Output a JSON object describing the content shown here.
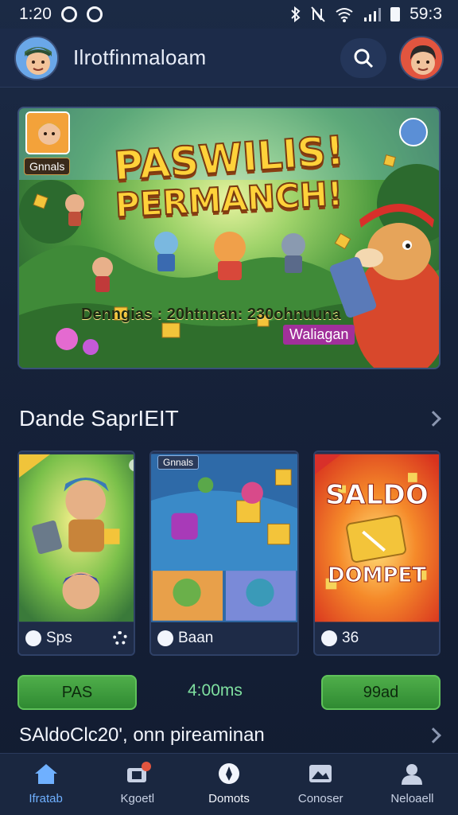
{
  "status_bar": {
    "time": "1:20",
    "battery_time": "59:3"
  },
  "header": {
    "title": "Ilrotfinmaloam"
  },
  "hero": {
    "title_line1": "PASWILIS!",
    "title_line2": "PERMANCH!",
    "chip": "Gnnals",
    "stats": "Denngias : 20htnnan: 230ohnuuna",
    "badge": "Waliagan"
  },
  "section1": {
    "title": "Dande SaprIEIT"
  },
  "cards": [
    {
      "label": "Sps"
    },
    {
      "badge": "Gnnals",
      "label": "Baan"
    },
    {
      "title_line1": "SALDO",
      "title_line2": "DOMPET",
      "label": "36"
    }
  ],
  "actions": {
    "left_button": "PAS",
    "timer": "4:00ms",
    "right_button": "99ad"
  },
  "section2": {
    "title": "SAldoClc20', onn pireaminan"
  },
  "nav": [
    {
      "label": "Ifratab",
      "icon": "home-icon"
    },
    {
      "label": "Kgoetl",
      "icon": "cart-icon"
    },
    {
      "label": "Domots",
      "icon": "compass-icon"
    },
    {
      "label": "Conoser",
      "icon": "image-icon"
    },
    {
      "label": "Neloaell",
      "icon": "profile-icon"
    }
  ],
  "colors": {
    "accent": "#6fb0ff",
    "button_green": "#3f9c3f",
    "background": "#16223a"
  }
}
